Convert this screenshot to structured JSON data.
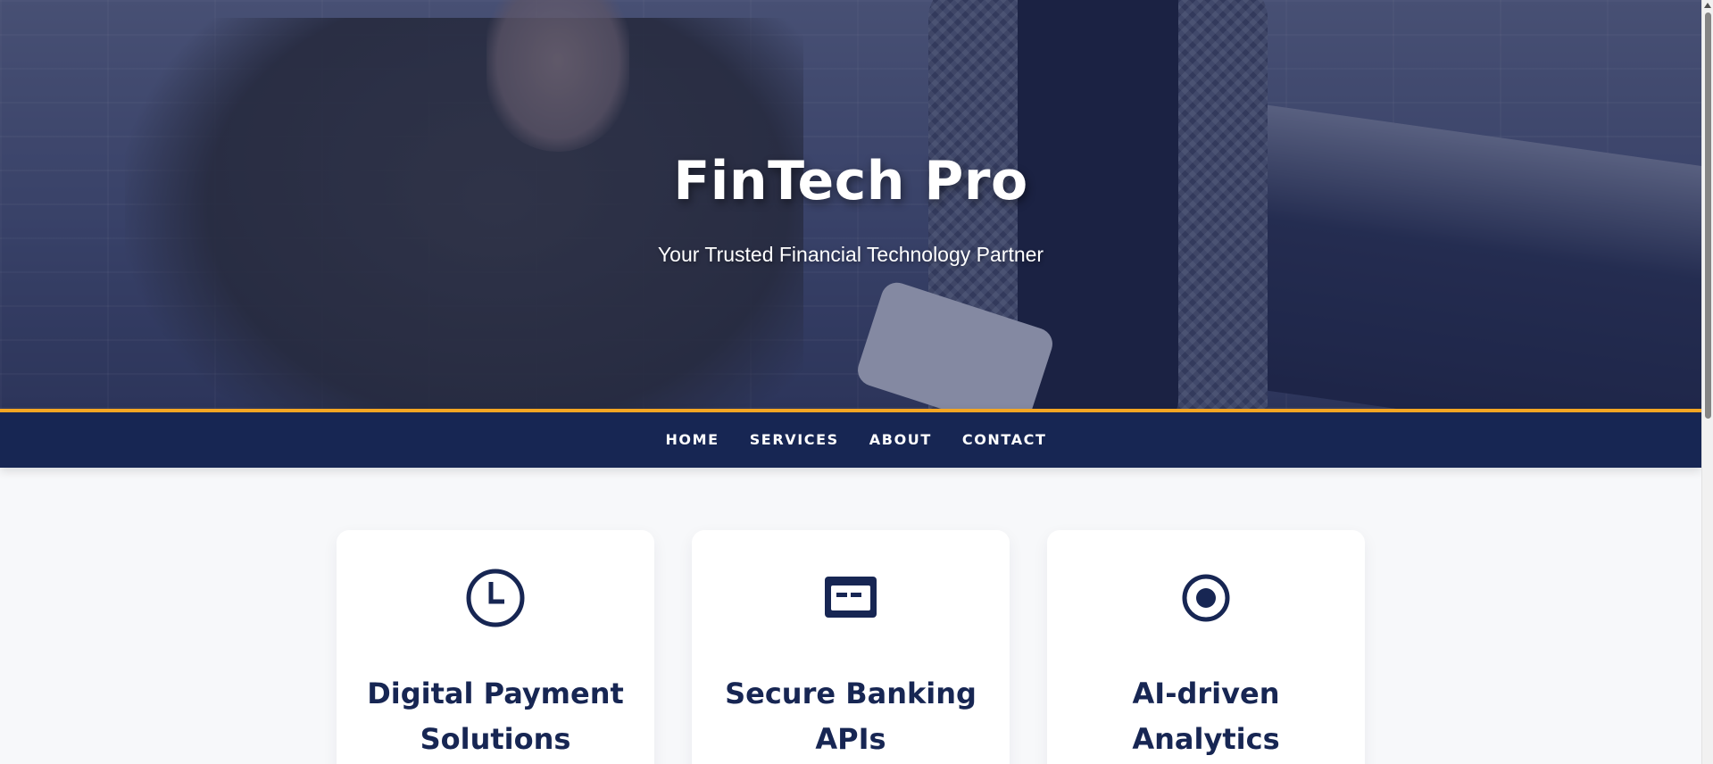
{
  "hero": {
    "title": "FinTech Pro",
    "subtitle": "Your Trusted Financial Technology Partner"
  },
  "nav": {
    "items": [
      {
        "label": "HOME"
      },
      {
        "label": "SERVICES"
      },
      {
        "label": "ABOUT"
      },
      {
        "label": "CONTACT"
      }
    ]
  },
  "services": [
    {
      "icon": "clock-icon",
      "title": "Digital Payment Solutions"
    },
    {
      "icon": "card-icon",
      "title": "Secure Banking APIs"
    },
    {
      "icon": "target-icon",
      "title": "AI-driven Analytics"
    }
  ],
  "colors": {
    "navy": "#172653",
    "accent": "#f5a623",
    "background": "#f7f8fa"
  }
}
